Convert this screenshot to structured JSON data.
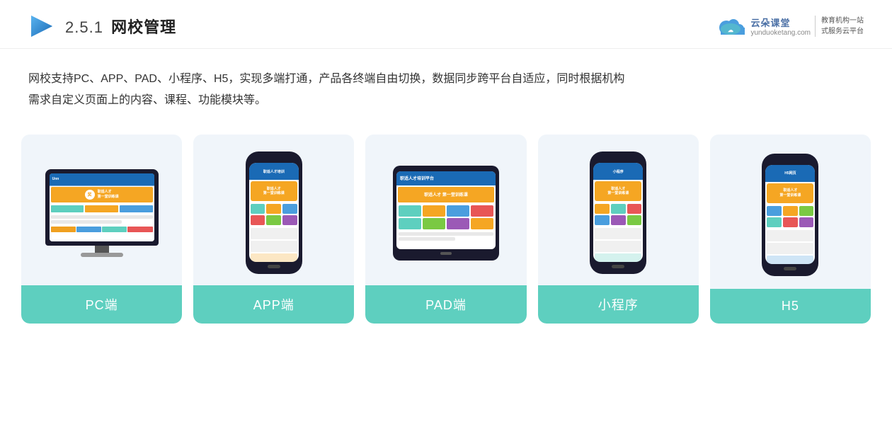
{
  "header": {
    "section_number": "2.5.1",
    "title": "网校管理",
    "brand": {
      "name": "云朵课堂",
      "url": "yunduoketang.com",
      "slogan_line1": "教育机构一站",
      "slogan_line2": "式服务云平台"
    }
  },
  "description": {
    "text_line1": "网校支持PC、APP、PAD、小程序、H5，实现多端打通，产品各终端自由切换，数据同步跨平台自适应，同时根据机构",
    "text_line2": "需求自定义页面上的内容、课程、功能模块等。"
  },
  "cards": [
    {
      "id": "pc",
      "label": "PC端"
    },
    {
      "id": "app",
      "label": "APP端"
    },
    {
      "id": "pad",
      "label": "PAD端"
    },
    {
      "id": "mini",
      "label": "小程序"
    },
    {
      "id": "h5",
      "label": "H5"
    }
  ]
}
